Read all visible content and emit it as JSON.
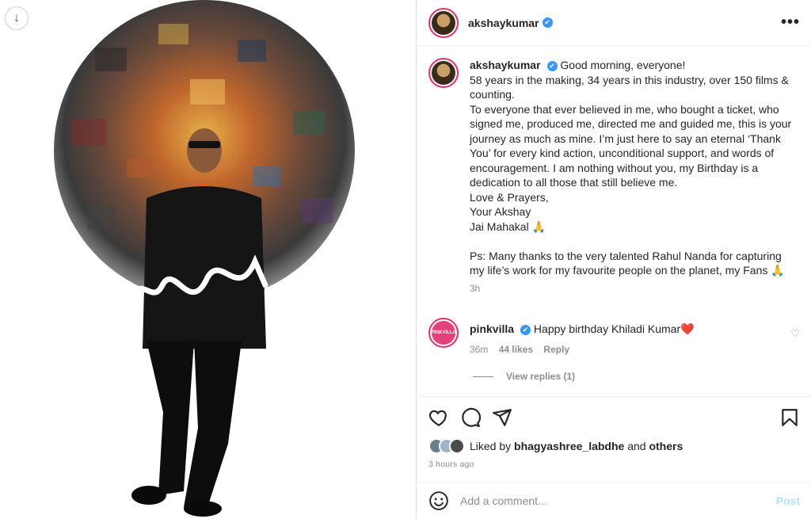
{
  "post": {
    "username": "akshaykumar",
    "verified_glyph": "✔",
    "more_glyph": "•••",
    "caption_lines": [
      "Good morning, everyone!",
      "58 years in the making, 34 years in this industry, over 150 films & counting.",
      "To everyone that ever believed in me, who bought a ticket, who signed me, produced me, directed me and guided me, this is your journey as much as mine. I’m just here to say an eternal ‘Thank You’ for every kind action, unconditional support, and words of encouragement. I am nothing without you, my Birthday is a dedication to all those that still believe me.",
      "Love & Prayers,",
      "Your Akshay",
      "Jai Mahakal 🙏",
      "",
      "Ps: Many thanks to the very talented Rahul Nanda for capturing my life’s work for my favourite people on the planet, my Fans 🙏"
    ],
    "caption_time": "3h",
    "signature_text": "Akshay"
  },
  "comment": {
    "avatar_text": "PINKVILLA",
    "username": "pinkvilla",
    "text": "Happy birthday Khiladi Kumar❤️",
    "time": "36m",
    "likes": "44 likes",
    "reply": "Reply",
    "view_replies": "View replies (1)"
  },
  "liked": {
    "prefix": "Liked by",
    "user": "bhagyashree_labdhe",
    "and": "and",
    "others": "others",
    "ago": "3 hours ago"
  },
  "add_comment": {
    "placeholder": "Add a comment...",
    "post": "Post"
  },
  "icons": {
    "download": "download-icon",
    "heart": "heart-icon",
    "comment": "comment-icon",
    "share": "share-icon",
    "bookmark": "bookmark-icon",
    "emoji": "emoji-icon"
  },
  "colors": {
    "verified": "#3897f0",
    "ring": "#e1306c",
    "post_disabled": "#b2dffc",
    "heart_red": "#ed4956"
  }
}
